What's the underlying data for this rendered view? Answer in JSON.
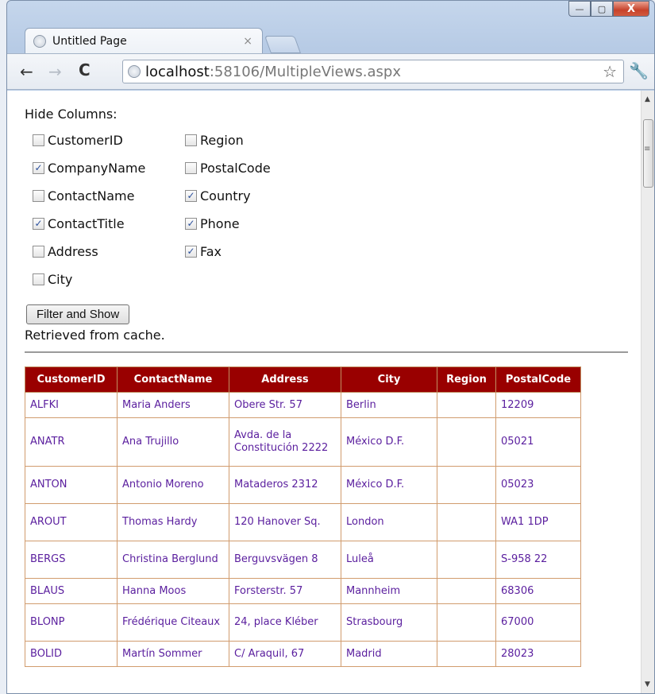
{
  "window": {
    "min_glyph": "—",
    "max_glyph": "▢",
    "close_glyph": "X"
  },
  "tab": {
    "title": "Untitled Page",
    "close_glyph": "×"
  },
  "toolbar": {
    "back_glyph": "←",
    "forward_glyph": "→",
    "reload_glyph": "C",
    "url_host": "localhost",
    "url_path": ":58106/MultipleViews.aspx",
    "star_glyph": "☆",
    "wrench_glyph": "🔧"
  },
  "page": {
    "hide_columns_label": "Hide Columns:",
    "checkboxes_col1": [
      {
        "label": "CustomerID",
        "checked": false
      },
      {
        "label": "CompanyName",
        "checked": true
      },
      {
        "label": "ContactName",
        "checked": false
      },
      {
        "label": "ContactTitle",
        "checked": true
      },
      {
        "label": "Address",
        "checked": false
      },
      {
        "label": "City",
        "checked": false
      }
    ],
    "checkboxes_col2": [
      {
        "label": "Region",
        "checked": false
      },
      {
        "label": "PostalCode",
        "checked": false
      },
      {
        "label": "Country",
        "checked": true
      },
      {
        "label": "Phone",
        "checked": true
      },
      {
        "label": "Fax",
        "checked": true
      }
    ],
    "filter_button_label": "Filter and Show",
    "status_text": "Retrieved from cache."
  },
  "table": {
    "columns": [
      "CustomerID",
      "ContactName",
      "Address",
      "City",
      "Region",
      "PostalCode"
    ],
    "rows": [
      [
        "ALFKI",
        "Maria Anders",
        "Obere Str. 57",
        "Berlin",
        "",
        "12209"
      ],
      [
        "ANATR",
        "Ana Trujillo",
        "Avda. de la Constitución 2222",
        "México D.F.",
        "",
        "05021"
      ],
      [
        "ANTON",
        "Antonio Moreno",
        "Mataderos 2312",
        "México D.F.",
        "",
        "05023"
      ],
      [
        "AROUT",
        "Thomas Hardy",
        "120 Hanover Sq.",
        "London",
        "",
        "WA1 1DP"
      ],
      [
        "BERGS",
        "Christina Berglund",
        "Berguvsvägen 8",
        "Luleå",
        "",
        "S-958 22"
      ],
      [
        "BLAUS",
        "Hanna Moos",
        "Forsterstr. 57",
        "Mannheim",
        "",
        "68306"
      ],
      [
        "BLONP",
        "Frédérique Citeaux",
        "24, place Kléber",
        "Strasbourg",
        "",
        "67000"
      ],
      [
        "BOLID",
        "Martín Sommer",
        "C/ Araquil, 67",
        "Madrid",
        "",
        "28023"
      ]
    ]
  },
  "scrollbar": {
    "up_glyph": "▲",
    "down_glyph": "▼",
    "grip_glyph": "≡"
  }
}
